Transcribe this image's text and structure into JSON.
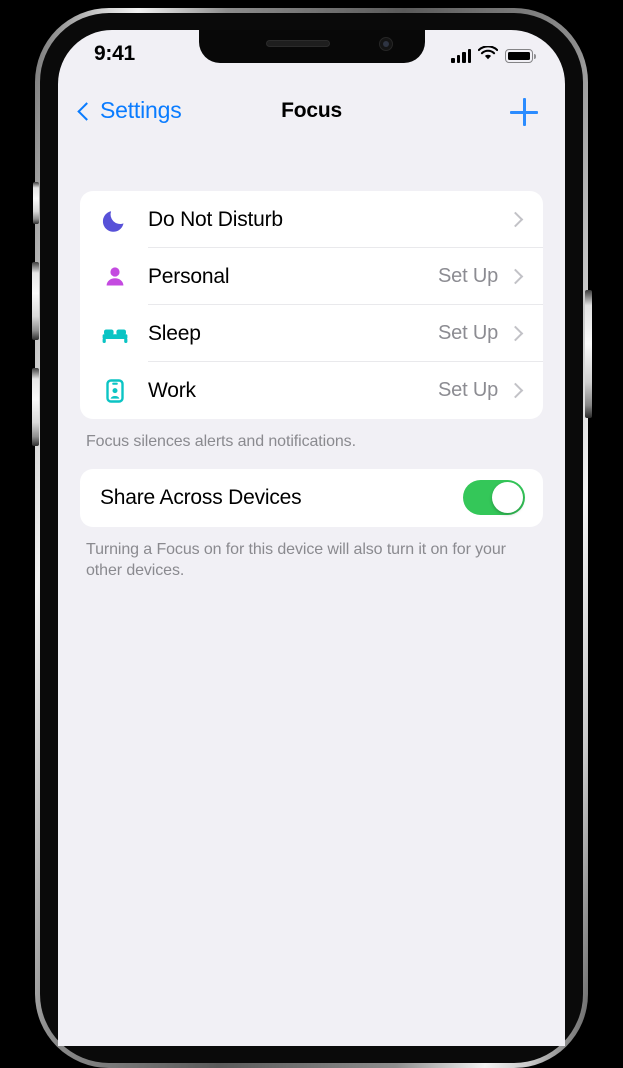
{
  "status_bar": {
    "time": "9:41",
    "signal_icon": "cellular-signal-icon",
    "wifi_icon": "wifi-icon",
    "battery_icon": "battery-full-icon"
  },
  "nav": {
    "back_label": "Settings",
    "back_icon": "chevron-left-icon",
    "title": "Focus",
    "add_icon": "plus-icon"
  },
  "focus_list": {
    "rows": [
      {
        "label": "Do Not Disturb",
        "value": "",
        "icon": "moon-icon",
        "icon_color": "#5751d8"
      },
      {
        "label": "Personal",
        "value": "Set Up",
        "icon": "person-icon",
        "icon_color": "#c44ae0"
      },
      {
        "label": "Sleep",
        "value": "Set Up",
        "icon": "bed-icon",
        "icon_color": "#0bc4c4"
      },
      {
        "label": "Work",
        "value": "Set Up",
        "icon": "id-badge-icon",
        "icon_color": "#0bc4c4"
      }
    ],
    "footnote": "Focus silences alerts and notifications."
  },
  "share_section": {
    "label": "Share Across Devices",
    "toggle_on": true,
    "toggle_color": "#34c759",
    "footnote": "Turning a Focus on for this device will also turn it on for your other devices."
  },
  "colors": {
    "accent_blue": "#0a7cff",
    "screen_background": "#f1f0f5",
    "card_background": "#ffffff",
    "secondary_text": "#8a8a8f"
  }
}
